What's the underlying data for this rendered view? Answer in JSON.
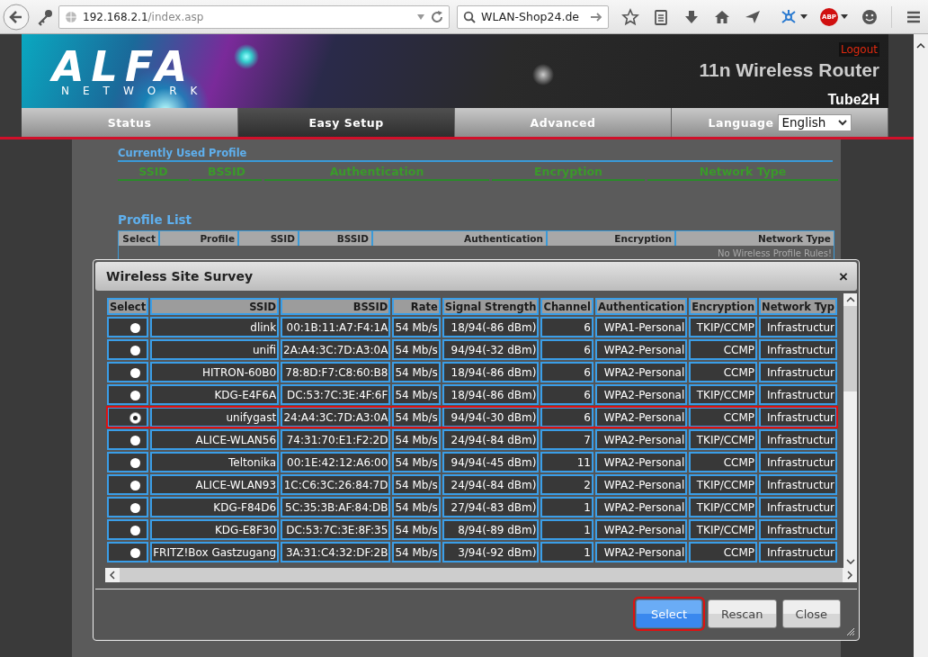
{
  "browser": {
    "url": {
      "host": "192.168.2.1",
      "path": "/index.asp"
    },
    "search": "WLAN-Shop24.de",
    "adblock_label": "ABP"
  },
  "header": {
    "logo": "ALFA",
    "logo_sub": "NETWORK",
    "logout": "Logout",
    "product": "11n Wireless Router",
    "model": "Tube2H"
  },
  "nav": {
    "tabs": [
      {
        "label": "Status",
        "selected": false
      },
      {
        "label": "Easy Setup",
        "selected": true
      },
      {
        "label": "Advanced",
        "selected": false
      }
    ],
    "language_label": "Language",
    "language": "English"
  },
  "current_profile": {
    "title": "Currently Used Profile",
    "columns": [
      "SSID",
      "BSSID",
      "Authentication",
      "Encryption",
      "Network Type"
    ]
  },
  "profile_list": {
    "title": "Profile List",
    "columns": [
      "Select",
      "Profile",
      "SSID",
      "BSSID",
      "Authentication",
      "Encryption",
      "Network Type"
    ],
    "empty": "No Wireless Profile Rules!"
  },
  "dialog": {
    "title": "Wireless Site Survey",
    "close": "×",
    "select_column": "Select",
    "columns": [
      "SSID",
      "BSSID",
      "Rate",
      "Signal Strength",
      "Channel",
      "Authentication",
      "Encryption",
      "Network Typ"
    ],
    "rows": [
      {
        "selected": false,
        "cells": [
          "dlink",
          "00:1B:11:A7:F4:1A",
          "54 Mb/s",
          "18/94(-86 dBm)",
          "6",
          "WPA1-Personal",
          "TKIP/CCMP",
          "Infrastructur"
        ]
      },
      {
        "selected": false,
        "cells": [
          "unifi",
          "2A:A4:3C:7D:A3:0A",
          "54 Mb/s",
          "94/94(-32 dBm)",
          "6",
          "WPA2-Personal",
          "CCMP",
          "Infrastructur"
        ]
      },
      {
        "selected": false,
        "cells": [
          "HITRON-60B0",
          "78:8D:F7:C8:60:B8",
          "54 Mb/s",
          "18/94(-86 dBm)",
          "6",
          "WPA2-Personal",
          "CCMP",
          "Infrastructur"
        ]
      },
      {
        "selected": false,
        "cells": [
          "KDG-E4F6A",
          "DC:53:7C:3E:4F:6F",
          "54 Mb/s",
          "18/94(-86 dBm)",
          "6",
          "WPA2-Personal",
          "TKIP/CCMP",
          "Infrastructur"
        ]
      },
      {
        "selected": true,
        "cells": [
          "unifygast",
          "24:A4:3C:7D:A3:0A",
          "54 Mb/s",
          "94/94(-30 dBm)",
          "6",
          "WPA2-Personal",
          "CCMP",
          "Infrastructur"
        ]
      },
      {
        "selected": false,
        "cells": [
          "ALICE-WLAN56",
          "74:31:70:E1:F2:2D",
          "54 Mb/s",
          "24/94(-84 dBm)",
          "7",
          "WPA2-Personal",
          "TKIP/CCMP",
          "Infrastructur"
        ]
      },
      {
        "selected": false,
        "cells": [
          "Teltonika",
          "00:1E:42:12:A6:00",
          "54 Mb/s",
          "94/94(-45 dBm)",
          "11",
          "WPA2-Personal",
          "CCMP",
          "Infrastructur"
        ]
      },
      {
        "selected": false,
        "cells": [
          "ALICE-WLAN93",
          "1C:C6:3C:26:84:7D",
          "54 Mb/s",
          "24/94(-84 dBm)",
          "2",
          "WPA2-Personal",
          "TKIP/CCMP",
          "Infrastructur"
        ]
      },
      {
        "selected": false,
        "cells": [
          "KDG-F84D6",
          "5C:35:3B:AF:84:DB",
          "54 Mb/s",
          "27/94(-83 dBm)",
          "1",
          "WPA2-Personal",
          "TKIP/CCMP",
          "Infrastructur"
        ]
      },
      {
        "selected": false,
        "cells": [
          "KDG-E8F30",
          "DC:53:7C:3E:8F:35",
          "54 Mb/s",
          "8/94(-89 dBm)",
          "1",
          "WPA2-Personal",
          "TKIP/CCMP",
          "Infrastructur"
        ]
      },
      {
        "selected": false,
        "cells": [
          "FRITZ!Box Gastzugang",
          "3A:31:C4:32:DF:2B",
          "54 Mb/s",
          "3/94(-92 dBm)",
          "1",
          "WPA2-Personal",
          "CCMP",
          "Infrastructur"
        ]
      }
    ],
    "buttons": [
      {
        "label": "Select",
        "kind": "primary",
        "highlighted": true
      },
      {
        "label": "Rescan",
        "kind": "default",
        "highlighted": false
      },
      {
        "label": "Close",
        "kind": "default",
        "highlighted": false
      }
    ]
  }
}
